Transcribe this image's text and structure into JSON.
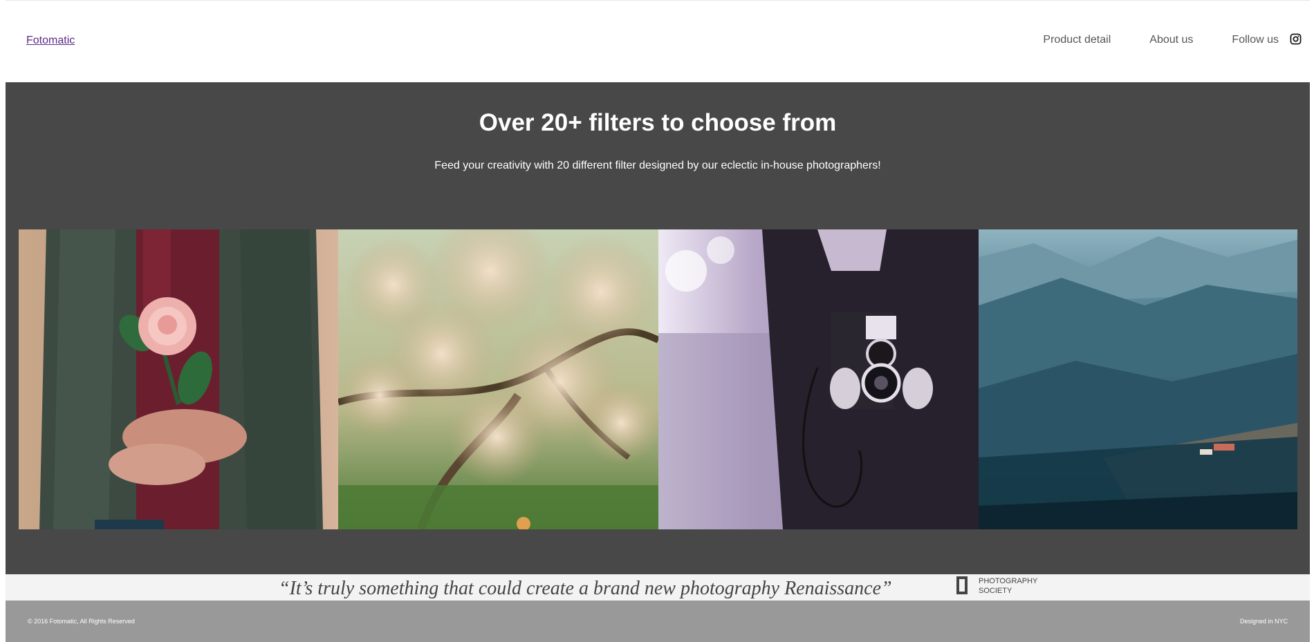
{
  "nav": {
    "brand": "Fotomatic",
    "links": [
      "Product detail",
      "About us",
      "Follow us"
    ],
    "follow_icon": "instagram-icon"
  },
  "feature": {
    "title": "Over 20+ filters to choose from",
    "subtitle": "Feed your creativity with 20 different filter designed by our eclectic in-house photographers!",
    "photos": [
      "flower-photo",
      "blossom-photo",
      "camera-photo",
      "valley-photo"
    ]
  },
  "testimonial": {
    "quote": "“It’s truly something that could create a brand new photography Renaissance”",
    "source_line1": "PHOTOGRAPHY",
    "source_line2": "SOCIETY"
  },
  "footer": {
    "copyright": "© 2016 Fotomatic, All Rights Reserved",
    "designed": "Designed in NYC"
  },
  "colors": {
    "feature_bg": "#484848",
    "testimonial_bg": "#f3f3f3",
    "footer_bg": "#999999",
    "brand_link": "#5a2b86"
  }
}
